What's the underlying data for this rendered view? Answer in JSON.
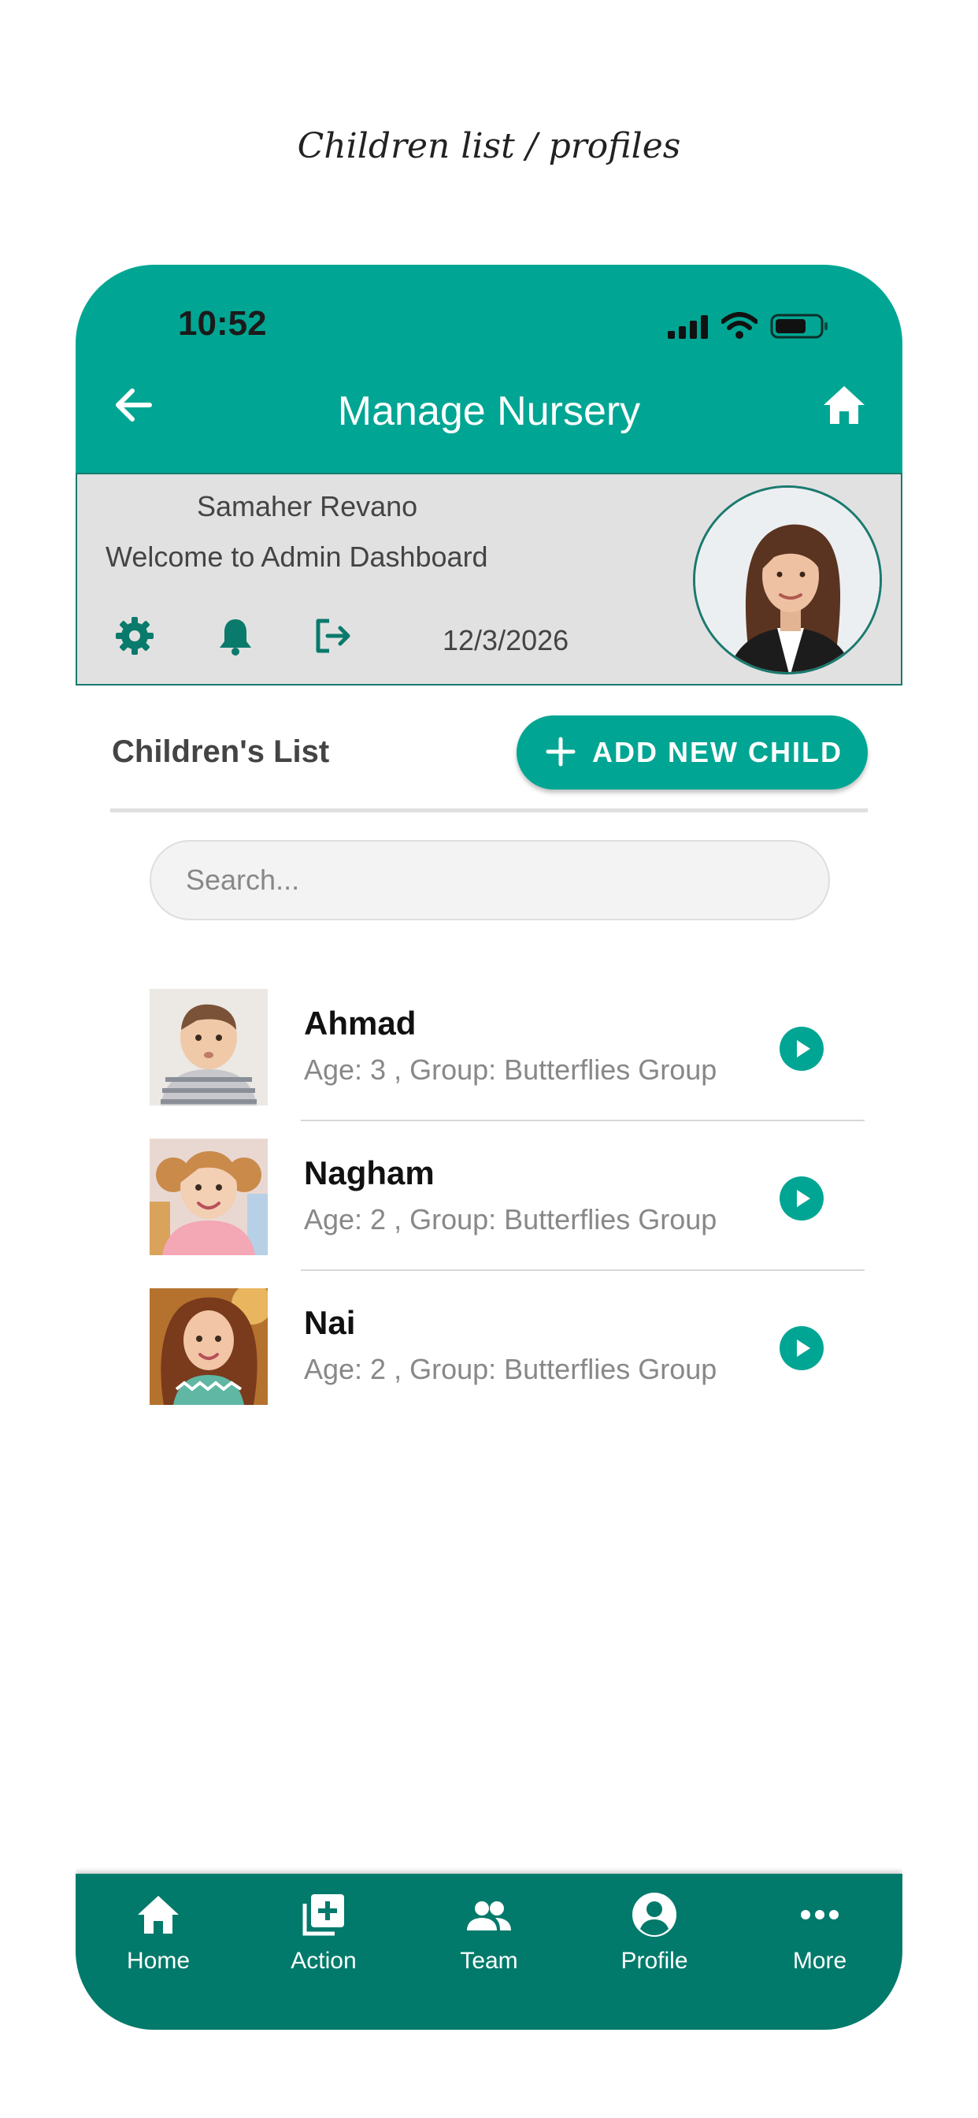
{
  "caption": "Children list / profiles",
  "status_bar": {
    "time": "10:52",
    "icons": [
      "signal-icon",
      "wifi-icon",
      "battery-icon"
    ]
  },
  "header": {
    "title": "Manage Nursery",
    "back_icon": "arrow-left-icon",
    "home_icon": "home-icon"
  },
  "admin": {
    "name": "Samaher Revano",
    "welcome": "Welcome to Admin Dashboard",
    "date": "12/3/2026",
    "actions": [
      "gear-icon",
      "bell-icon",
      "logout-icon"
    ]
  },
  "list": {
    "title": "Children's List",
    "add_button": "ADD NEW CHILD",
    "search_placeholder": "Search...",
    "children": [
      {
        "name": "Ahmad",
        "info": "Age: 3 , Group: Butterflies Group"
      },
      {
        "name": "Nagham",
        "info": "Age: 2 , Group: Butterflies Group"
      },
      {
        "name": "Nai",
        "info": "Age: 2 , Group: Butterflies Group"
      }
    ]
  },
  "nav": [
    {
      "label": "Home",
      "icon": "home-icon"
    },
    {
      "label": "Action",
      "icon": "add-box-icon"
    },
    {
      "label": "Team",
      "icon": "people-icon"
    },
    {
      "label": "Profile",
      "icon": "account-circle-icon"
    },
    {
      "label": "More",
      "icon": "more-dots-icon"
    }
  ],
  "colors": {
    "primary": "#00a693",
    "nav_bg": "#017a6b",
    "panel_bg": "#e1e1e1"
  }
}
